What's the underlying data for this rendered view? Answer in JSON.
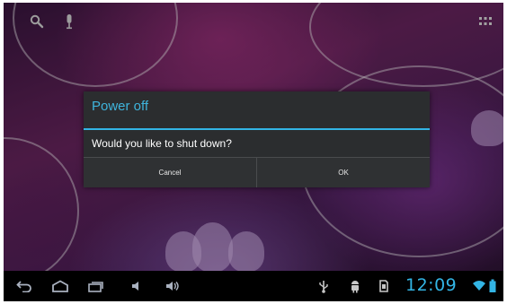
{
  "top_bar": {
    "search_icon": "search-icon",
    "voice_icon": "microphone-icon",
    "apps_icon": "all-apps-grid-icon"
  },
  "dialog": {
    "title": "Power off",
    "message": "Would you like to shut down?",
    "cancel_label": "Cancel",
    "ok_label": "OK"
  },
  "nav_bar": {
    "back_icon": "back-icon",
    "home_icon": "home-icon",
    "recents_icon": "recent-apps-icon",
    "volume_down_icon": "volume-down-icon",
    "volume_up_icon": "volume-up-icon"
  },
  "status": {
    "usb_icon": "usb-icon",
    "debug_icon": "android-debug-icon",
    "sd_icon": "sd-card-icon",
    "time": "12:09",
    "wifi_icon": "wifi-icon",
    "battery_icon": "battery-icon"
  },
  "colors": {
    "accent": "#33b5e5",
    "dialog_bg": "#2b2d2f",
    "nav_bg": "#000000"
  }
}
